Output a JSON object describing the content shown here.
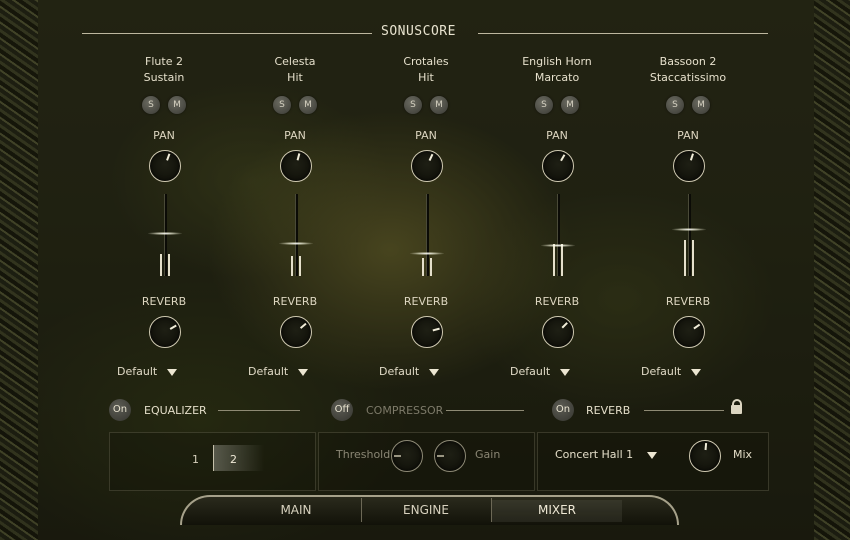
{
  "logo": "SONUSCORE",
  "channels": [
    {
      "name": "Flute 2",
      "articulation": "Sustain",
      "solo": "S",
      "mute": "M",
      "pan_label": "PAN",
      "reverb_label": "REVERB",
      "preset": "Default"
    },
    {
      "name": "Celesta",
      "articulation": "Hit",
      "solo": "S",
      "mute": "M",
      "pan_label": "PAN",
      "reverb_label": "REVERB",
      "preset": "Default"
    },
    {
      "name": "Crotales",
      "articulation": "Hit",
      "solo": "S",
      "mute": "M",
      "pan_label": "PAN",
      "reverb_label": "REVERB",
      "preset": "Default"
    },
    {
      "name": "English Horn",
      "articulation": "Marcato",
      "solo": "S",
      "mute": "M",
      "pan_label": "PAN",
      "reverb_label": "REVERB",
      "preset": "Default"
    },
    {
      "name": "Bassoon 2",
      "articulation": "Staccatissimo",
      "solo": "S",
      "mute": "M",
      "pan_label": "PAN",
      "reverb_label": "REVERB",
      "preset": "Default"
    }
  ],
  "equalizer": {
    "toggle": "On",
    "label": "EQUALIZER",
    "band1": "1",
    "band2": "2"
  },
  "compressor": {
    "toggle": "Off",
    "label": "COMPRESSOR",
    "threshold_label": "Threshold",
    "gain_label": "Gain"
  },
  "reverb": {
    "toggle": "On",
    "label": "REVERB",
    "preset": "Concert Hall 1",
    "mix_label": "Mix"
  },
  "tabs": {
    "main": "MAIN",
    "engine": "ENGINE",
    "mixer": "MIXER",
    "active": "MIXER"
  },
  "colors": {
    "text": "#e6e0cc",
    "accent": "#cfc9b1",
    "dim": "#8a8674"
  }
}
